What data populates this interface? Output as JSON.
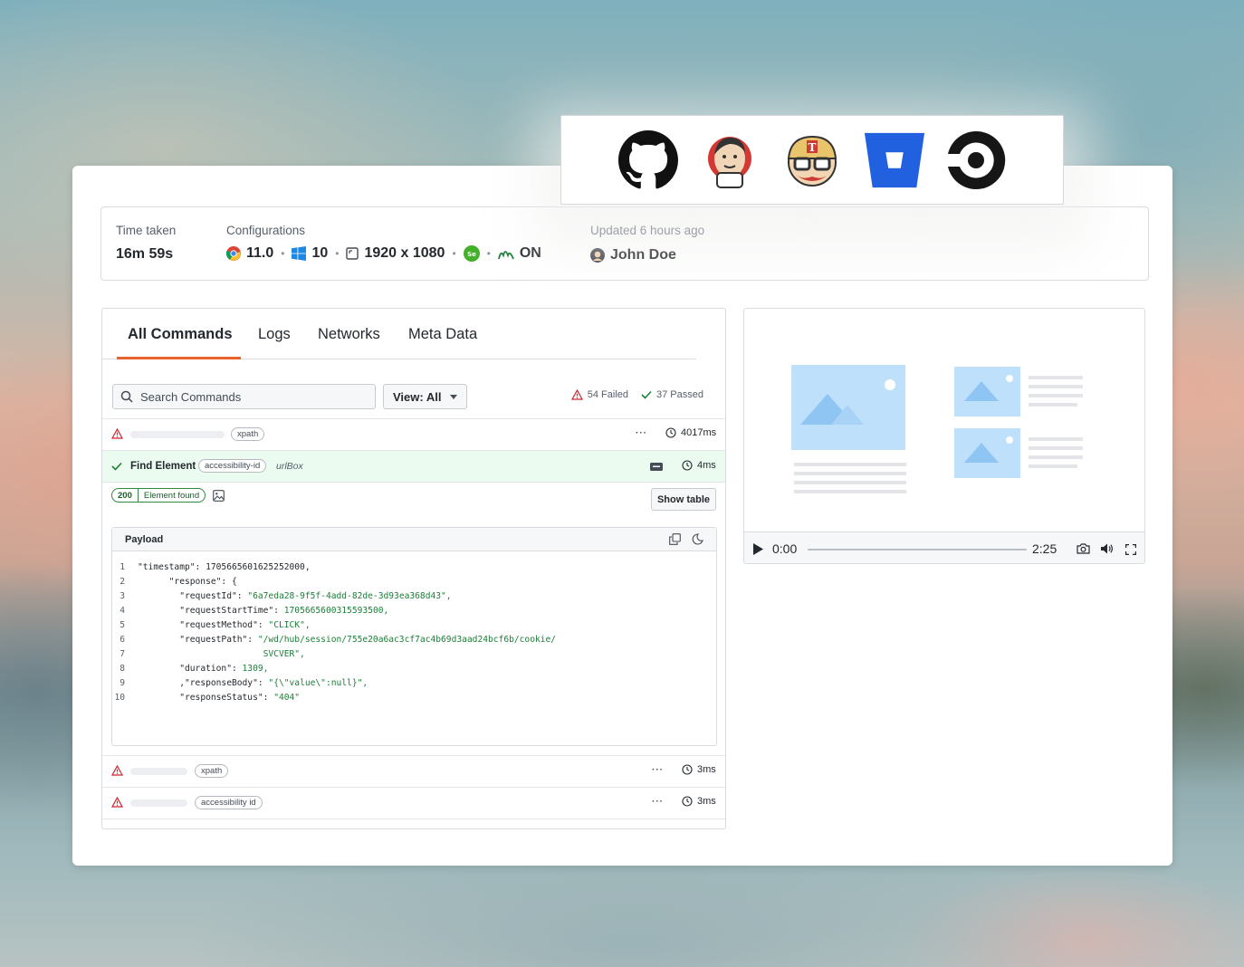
{
  "integrations": [
    "github-icon",
    "jenkins-icon",
    "travis-ci-icon",
    "bitbucket-icon",
    "circleci-icon"
  ],
  "info": {
    "time_label": "Time taken",
    "time_value": "16m 59s",
    "config_label": "Configurations",
    "browser_version": "11.0",
    "os_version": "10",
    "resolution": "1920 x 1080",
    "network_state": "ON",
    "updated_label": "Updated 6 hours ago",
    "user_name": "John Doe"
  },
  "tabs": [
    "All Commands",
    "Logs",
    "Networks",
    "Meta Data"
  ],
  "search": {
    "placeholder": "Search Commands"
  },
  "view_select": "View: All",
  "stats": {
    "failed": "54 Failed",
    "passed": "37 Passed"
  },
  "rows": [
    {
      "pill": "xpath",
      "time": "4017ms"
    },
    {
      "title": "Find Element",
      "pill": "accessibility-id",
      "locator": "urlBox",
      "time": "4ms"
    },
    {
      "pill": "xpath",
      "time": "3ms"
    },
    {
      "pill": "accessibility id",
      "time": "3ms"
    }
  ],
  "status": {
    "code": "200",
    "message": "Element found"
  },
  "show_table": "Show table",
  "payload": {
    "title": "Payload",
    "lines": [
      {
        "n": "1",
        "indent": "",
        "key": "\"timestamp\": ",
        "val": "1705665601625252000,",
        "kind": "plain"
      },
      {
        "n": "2",
        "indent": "      ",
        "key": "\"response\": {",
        "val": "",
        "kind": "plain"
      },
      {
        "n": "3",
        "indent": "        ",
        "key": "\"requestId\": ",
        "val": "\"6a7eda28-9f5f-4add-82de-3d93ea368d43\",",
        "kind": "str"
      },
      {
        "n": "4",
        "indent": "        ",
        "key": "\"requestStartTime\": ",
        "val": "1705665600315593500,",
        "kind": "num"
      },
      {
        "n": "5",
        "indent": "        ",
        "key": "\"requestMethod\": ",
        "val": "\"CLICK\",",
        "kind": "str"
      },
      {
        "n": "6",
        "indent": "        ",
        "key": "\"requestPath\": ",
        "val": "\"/wd/hub/session/755e20a6ac3cf7ac4b69d3aad24bcf6b/cookie/",
        "kind": "str"
      },
      {
        "n": "7",
        "indent": "                        ",
        "key": "",
        "val": "SVCVER\",",
        "kind": "str"
      },
      {
        "n": "8",
        "indent": "        ",
        "key": "\"duration\": ",
        "val": "1309,",
        "kind": "num"
      },
      {
        "n": "9",
        "indent": "        ",
        "key": ",\"responseBody\": ",
        "val": "\"{\\\"value\\\":null}\",",
        "kind": "str"
      },
      {
        "n": "10",
        "indent": "        ",
        "key": "\"responseStatus\": ",
        "val": "\"404\"",
        "kind": "str"
      }
    ]
  },
  "video": {
    "current_time": "0:00",
    "duration": "2:25",
    "progress": 0
  },
  "colors": {
    "accent": "#e8622b",
    "success": "#1a7f37",
    "danger": "#cf222e",
    "placeholder": "#bfe0fb"
  }
}
